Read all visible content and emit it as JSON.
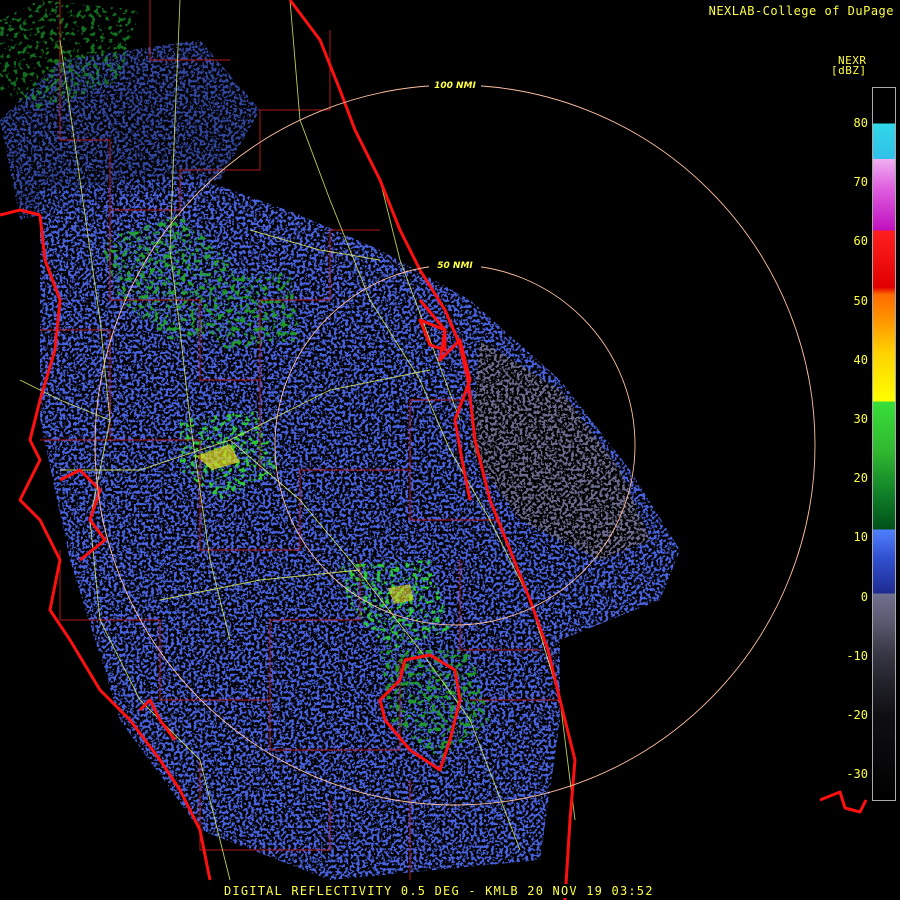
{
  "credit": "NEXLAB-College of DuPage",
  "product": "NEXR",
  "units": "[dBZ]",
  "footer": "DIGITAL REFLECTIVITY 0.5 DEG - KMLB 20 NOV 19 03:52",
  "range_rings": [
    {
      "label": "50 NMI",
      "nmi": 50
    },
    {
      "label": "100 NMI",
      "nmi": 100
    }
  ],
  "scale_ticks": [
    "80",
    "70",
    "60",
    "50",
    "40",
    "30",
    "20",
    "10",
    "0",
    "-10",
    "-20",
    "-30"
  ],
  "colors": {
    "coast": "#ff1010",
    "counties": "#b01818",
    "roads": "#e0f060",
    "rings": "#ffc0a0",
    "label": "#ffff44"
  }
}
